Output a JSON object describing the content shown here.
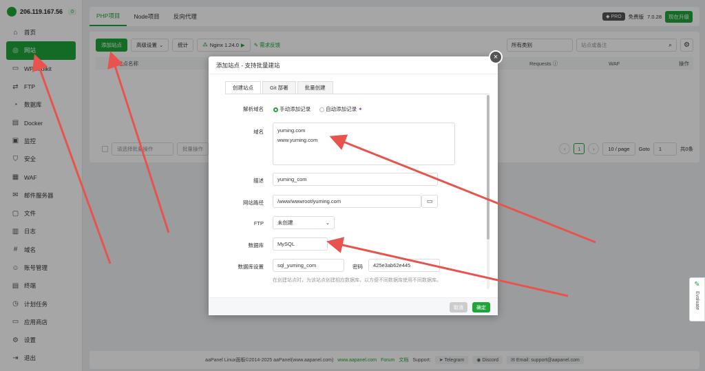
{
  "sidebar": {
    "ip": "206.119.167.56",
    "badge": "0",
    "items": [
      {
        "label": "首页",
        "icon": "home-icon"
      },
      {
        "label": "网站",
        "icon": "globe-icon"
      },
      {
        "label": "WP Toolkit",
        "icon": "wordpress-icon"
      },
      {
        "label": "FTP",
        "icon": "transfer-icon"
      },
      {
        "label": "数据库",
        "icon": "database-icon"
      },
      {
        "label": "Docker",
        "icon": "docker-icon"
      },
      {
        "label": "监控",
        "icon": "monitor-icon"
      },
      {
        "label": "安全",
        "icon": "shield-icon"
      },
      {
        "label": "WAF",
        "icon": "waf-icon"
      },
      {
        "label": "邮件服务器",
        "icon": "mail-icon"
      },
      {
        "label": "文件",
        "icon": "folder-icon"
      },
      {
        "label": "日志",
        "icon": "log-icon"
      },
      {
        "label": "域名",
        "icon": "domain-icon"
      },
      {
        "label": "账号管理",
        "icon": "user-icon"
      },
      {
        "label": "终端",
        "icon": "terminal-icon"
      },
      {
        "label": "计划任务",
        "icon": "clock-icon"
      },
      {
        "label": "应用商店",
        "icon": "store-icon"
      },
      {
        "label": "设置",
        "icon": "gear-icon"
      },
      {
        "label": "退出",
        "icon": "logout-icon"
      }
    ]
  },
  "topbar": {
    "tabs": [
      "PHP项目",
      "Node项目",
      "反向代理"
    ],
    "pro": "PRO",
    "free": "免费版",
    "version": "7.0.28",
    "upgrade": "现在升级"
  },
  "toolbar": {
    "add_site": "添加站点",
    "advanced": "高级设置",
    "stats": "统计",
    "nginx": "Nginx 1.24.0",
    "feedback": "需求反馈",
    "category": "所有类别",
    "search_placeholder": "站点或备注"
  },
  "table": {
    "col_name": "站点名称",
    "col_requests": "Requests",
    "col_waf": "WAF",
    "col_ops": "操作"
  },
  "pager": {
    "batch_select": "请选择批量操作",
    "batch_btn": "批量操作",
    "page": "1",
    "per_page": "10 / page",
    "goto": "Goto",
    "goto_val": "1",
    "total": "共0条"
  },
  "modal": {
    "title": "添加站点 - 支持批量建站",
    "tabs": [
      "创建站点",
      "Git 部署",
      "批量创建"
    ],
    "resolve_label": "解析域名",
    "resolve_manual": "手动添加记录",
    "resolve_auto": "自动添加记录",
    "domain_label": "域名",
    "domain_lines": [
      "yuming.com",
      "www.yuming.com"
    ],
    "desc_label": "描述",
    "desc_value": "yuming_com",
    "path_label": "网站路径",
    "path_value": "/www/wwwroot/yuming.com",
    "ftp_label": "FTP",
    "ftp_value": "未创建",
    "db_label": "数据库",
    "db_value": "MySQL",
    "dbset_label": "数据库设置",
    "db_user": "sql_yuming_com",
    "pwd_label": "密码",
    "db_pwd": "425e3ab62e445",
    "hint": "在创建站点时，为该站点创建相应数据库，以方便不同数据库使用不同数据库。",
    "cancel": "取消",
    "confirm": "确定"
  },
  "footer": {
    "copyright": "aaPanel Linux面板©2014-2025 aaPanel(www.aapanel.com)",
    "site": "www.aapanel.com",
    "forum": "Forum",
    "docs": "文档",
    "support": "Support:",
    "telegram": "Telegram",
    "discord": "Discord",
    "email": "Email: support@aapanel.com"
  },
  "evaluate": "Evaluate",
  "colors": {
    "accent": "#20a53a",
    "arrow": "#e8534d"
  }
}
